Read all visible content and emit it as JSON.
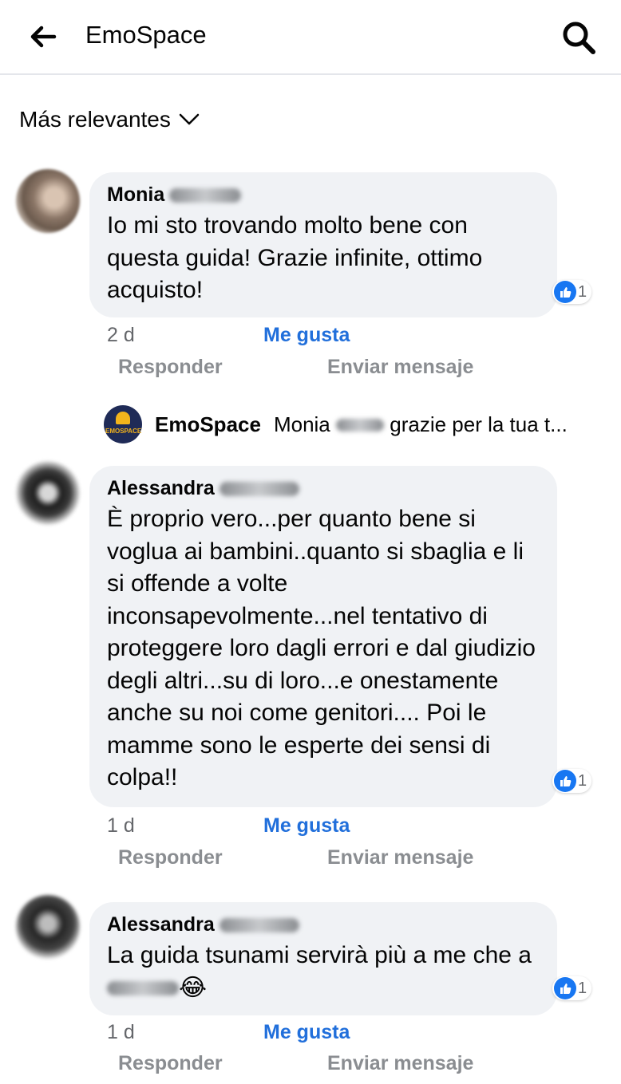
{
  "header": {
    "title": "EmoSpace",
    "back_icon": "arrow-left-icon",
    "search_icon": "search-icon"
  },
  "sort": {
    "label": "Más relevantes"
  },
  "colors": {
    "link": "#216fdb",
    "bubble": "#f0f2f5",
    "muted": "#65676b",
    "like_badge": "#1877f2"
  },
  "comments": [
    {
      "author": "Monia",
      "text": "Io mi sto trovando molto bene con questa guida! Grazie infinite, ottimo acquisto!",
      "reaction_count": "1",
      "time": "2 d",
      "like_label": "Me gusta",
      "reply_label": "Responder",
      "message_label": "Enviar mensaje"
    },
    {
      "author": "Alessandra",
      "text": "È proprio vero...per quanto bene si voglua ai bambini..quanto si sbaglia e li si offende a volte inconsapevolmente...nel tentativo di proteggere loro dagli errori e dal giudizio degli altri...su di loro...e onestamente anche su noi come genitori.... Poi le mamme sono le esperte dei sensi di colpa!!",
      "reaction_count": "1",
      "time": "1 d",
      "like_label": "Me gusta",
      "reply_label": "Responder",
      "message_label": "Enviar mensaje"
    },
    {
      "author": "Alessandra",
      "text_start": "La guida tsunami servirà più a me che a",
      "emoji": "😂",
      "reaction_count": "1",
      "time": "1 d",
      "like_label": "Me gusta",
      "reply_label": "Responder",
      "message_label": "Enviar mensaje"
    }
  ],
  "page_reply": {
    "author": "EmoSpace",
    "text_start": "Monia",
    "text_end": "grazie per la tua t...",
    "logo_text": "EMOSPACE"
  }
}
